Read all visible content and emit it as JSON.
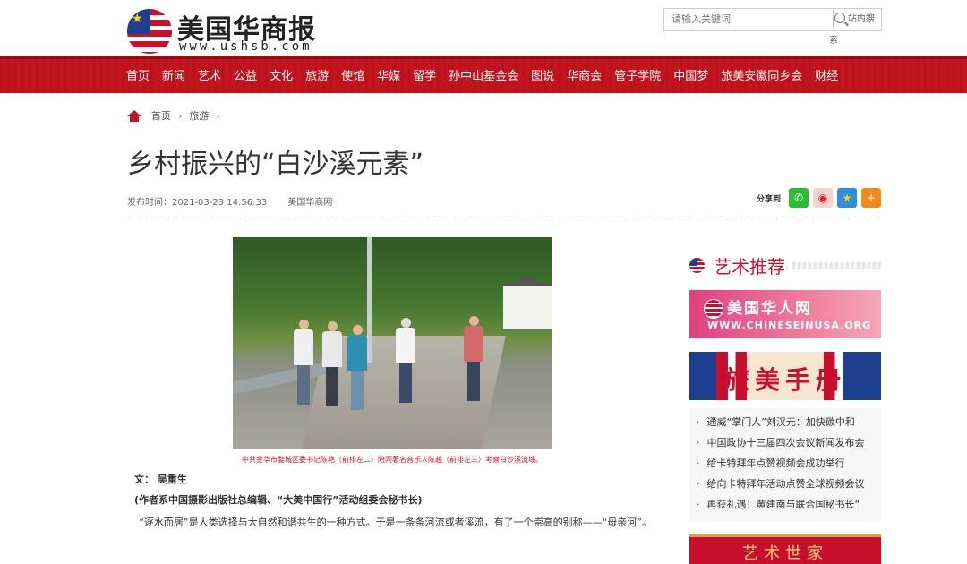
{
  "header": {
    "logo_title": "美国华商报",
    "logo_url": "www.ushsb.com",
    "search_placeholder": "请输入关键词",
    "search_button": "站内搜索"
  },
  "nav": [
    "首页",
    "新闻",
    "艺术",
    "公益",
    "文化",
    "旅游",
    "使馆",
    "华媒",
    "留学",
    "孙中山基金会",
    "图说",
    "华商会",
    "管子学院",
    "中国梦",
    "旅美安徽同乡会",
    "财经"
  ],
  "breadcrumb": {
    "home": "首页",
    "section": "旅游"
  },
  "article": {
    "title": "乡村振兴的“白沙溪元素”",
    "published": "发布时间：2021-03-23 14:56:33",
    "source": "美国华商网",
    "share_label": "分享到",
    "photo_caption": "中共金华市婺城区委书记陈艳（前排左二）陪同著名音乐人陈越（前排左三）考察白沙溪流域。",
    "author": "文：  吴重生",
    "author_note": "(作者系中国摄影出版社总编辑、“大美中国行”活动组委会秘书长)",
    "paragraph": "“逐水而居”是人类选择与大自然和谐共生的一种方式。于是一条条河流或者溪流，有了一个崇高的别称——“母亲河”。"
  },
  "sidebar": {
    "heading": "艺术推荐",
    "ad1_title": "美国华人网",
    "ad1_url": "WWW.CHINESEINUSA.ORG",
    "ad2_title": "旅美手册",
    "news": [
      "通威“掌门人”刘汉元：加快碳中和",
      "中国政协十三届四次会议新闻发布会",
      "给卡特拜年点赞视频会成功举行",
      "给向卡特拜年活动点赞全球视频会议",
      "再获礼遇！黄建南与联合国秘书长“"
    ],
    "ad3_title": "艺术世家"
  },
  "colors": {
    "brand_red": "#c2141c",
    "accent_red": "#c8102e",
    "navy": "#1d3f8f"
  },
  "icons": [
    "home-icon",
    "search-icon",
    "wechat-icon",
    "weibo-icon",
    "qzone-icon",
    "more-share-icon"
  ]
}
